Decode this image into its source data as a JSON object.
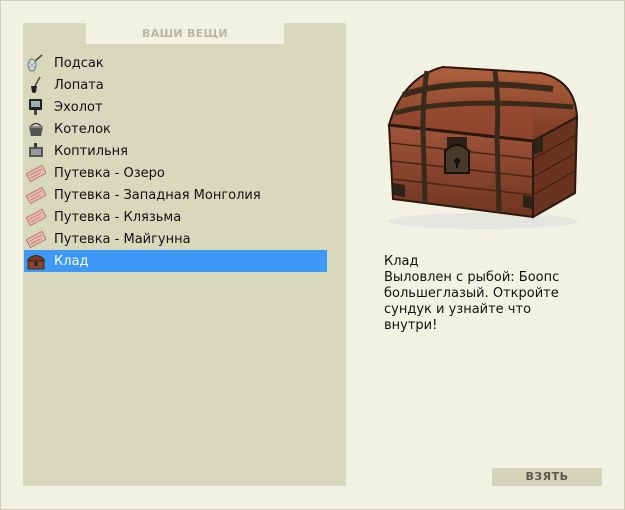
{
  "header": {
    "title": "ВАШИ ВЕЩИ"
  },
  "items": [
    {
      "label": "Подсак",
      "icon": "fishing-net-icon"
    },
    {
      "label": "Лопата",
      "icon": "shovel-icon"
    },
    {
      "label": "Эхолот",
      "icon": "echo-sounder-icon"
    },
    {
      "label": "Котелок",
      "icon": "kettle-icon"
    },
    {
      "label": "Коптильня",
      "icon": "smokehouse-icon"
    },
    {
      "label": "Путевка - Озеро",
      "icon": "ticket-icon"
    },
    {
      "label": "Путевка - Западная Монголия",
      "icon": "ticket-icon"
    },
    {
      "label": "Путевка - Клязьма",
      "icon": "ticket-icon"
    },
    {
      "label": "Путевка - Майгунна",
      "icon": "ticket-icon"
    },
    {
      "label": "Клад",
      "icon": "treasure-chest-icon",
      "selected": true
    }
  ],
  "detail": {
    "name": "Клад",
    "description": "Выловлен с рыбой: Боопс большеглазый. Откройте сундук и узнайте что внутри!",
    "image": "treasure-chest-image"
  },
  "actions": {
    "take_label": "ВЗЯТЬ"
  },
  "colors": {
    "background": "#f2f2e3",
    "panel": "#d8d8bd",
    "selection": "#3d99f5",
    "button": "#d4d4b8"
  }
}
